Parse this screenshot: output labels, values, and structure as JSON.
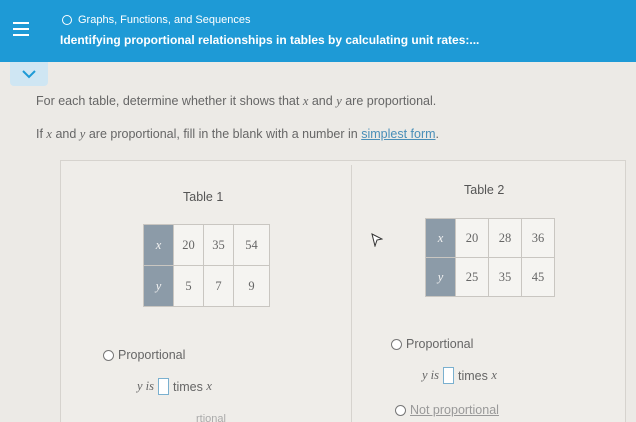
{
  "header": {
    "breadcrumb": "Graphs, Functions, and Sequences",
    "title": "Identifying proportional relationships in tables by calculating unit rates:..."
  },
  "instructions": {
    "line1_pre": "For each table, determine whether it shows that ",
    "var_x": "x",
    "line1_mid": " and ",
    "var_y": "y",
    "line1_post": " are proportional.",
    "line2_pre": "If ",
    "line2_mid": " and ",
    "line2_mid2": " are proportional, fill in the blank with a number in ",
    "line2_link": "simplest form",
    "line2_post": "."
  },
  "table1": {
    "caption": "Table 1",
    "x_label": "x",
    "y_label": "y",
    "x_values": [
      "20",
      "35",
      "54"
    ],
    "y_values": [
      "5",
      "7",
      "9"
    ]
  },
  "table2": {
    "caption": "Table 2",
    "x_label": "x",
    "y_label": "y",
    "x_values": [
      "20",
      "28",
      "36"
    ],
    "y_values": [
      "25",
      "35",
      "45"
    ]
  },
  "answers": {
    "proportional_label": "Proportional",
    "y_is": "y is",
    "times": "times",
    "x": "x",
    "not_proportional_label": "Not proportional",
    "faded_text": "rtional"
  },
  "colors": {
    "header_bg": "#1e9ad6",
    "table_header_bg": "#8c9ba8",
    "link": "#4a8fb8"
  }
}
